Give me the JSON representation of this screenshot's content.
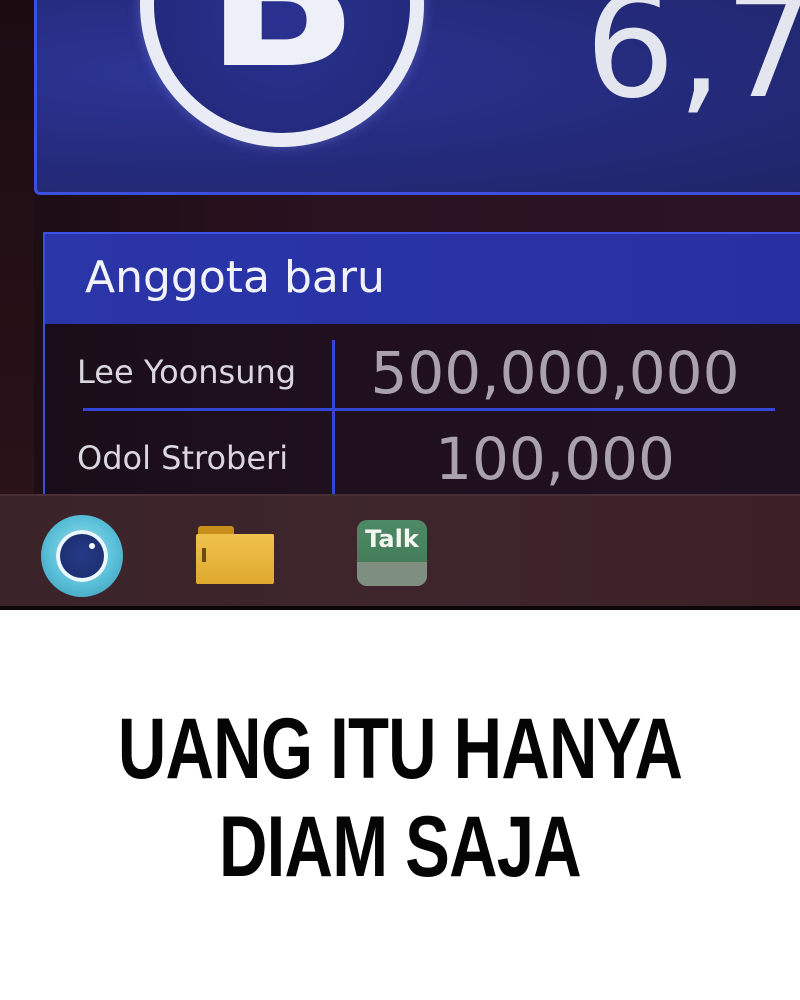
{
  "balance": {
    "logo_letter": "B",
    "amount": "6,7"
  },
  "members": {
    "title": "Anggota baru",
    "rows": [
      {
        "name": "Lee Yoonsung",
        "amount": "500,000,000"
      },
      {
        "name": "Odol Stroberi",
        "amount": "100,000"
      }
    ]
  },
  "taskbar": {
    "icons": [
      {
        "name": "assistant-icon"
      },
      {
        "name": "folder-icon"
      },
      {
        "name": "talk-icon",
        "label": "Talk"
      }
    ]
  },
  "caption": {
    "line1": "UANG ITU HANYA",
    "line2": "DIAM SAJA"
  },
  "colors": {
    "panel_blue": "#262c80",
    "accent_blue": "#3d4fe0",
    "taskbar": "#3a2429",
    "talk_green": "#4f8a66",
    "folder_yellow": "#f0c24c"
  }
}
